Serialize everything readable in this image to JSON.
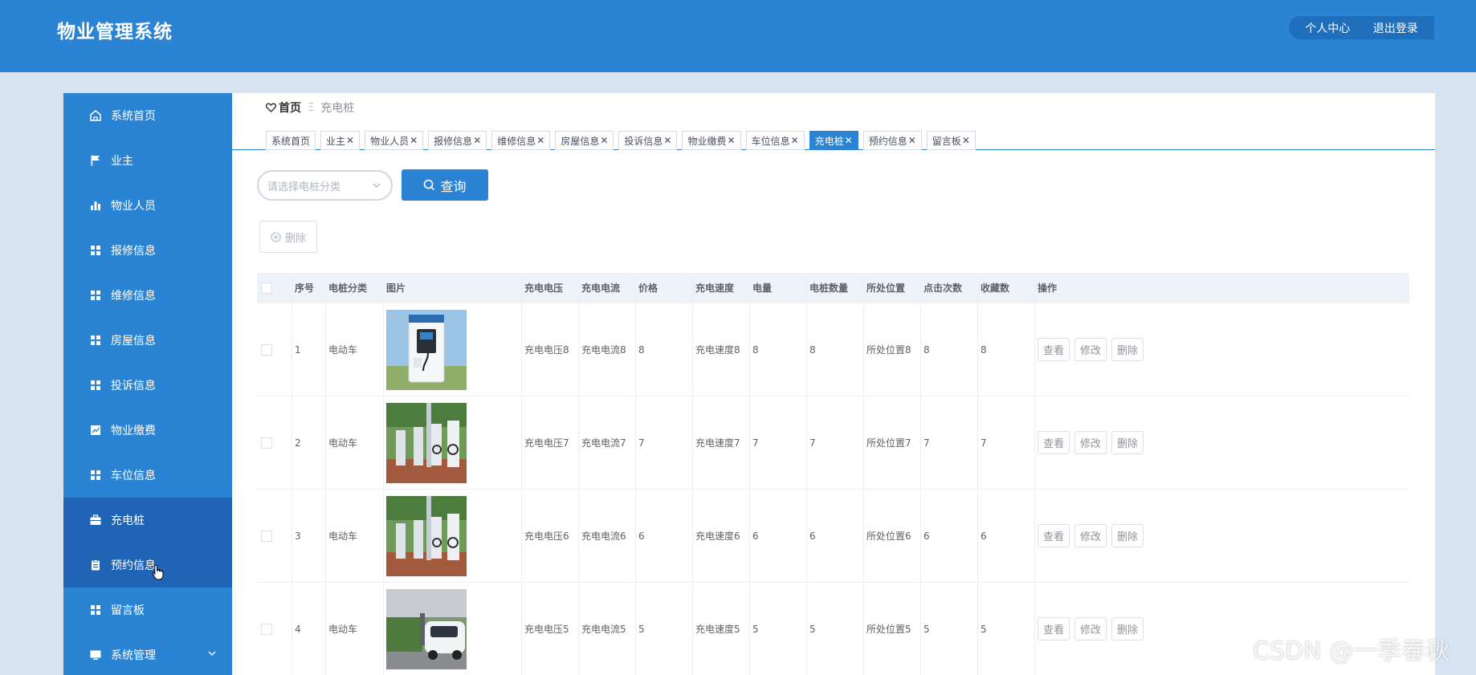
{
  "header": {
    "title": "物业管理系统",
    "personal_center": "个人中心",
    "logout": "退出登录"
  },
  "sidebar": {
    "items": [
      {
        "label": "系统首页",
        "icon": "home-icon"
      },
      {
        "label": "业主",
        "icon": "flag-icon"
      },
      {
        "label": "物业人员",
        "icon": "bar-chart-icon"
      },
      {
        "label": "报修信息",
        "icon": "grid-icon"
      },
      {
        "label": "维修信息",
        "icon": "grid-icon"
      },
      {
        "label": "房屋信息",
        "icon": "grid-icon"
      },
      {
        "label": "投诉信息",
        "icon": "grid-icon"
      },
      {
        "label": "物业缴费",
        "icon": "line-chart-icon"
      },
      {
        "label": "车位信息",
        "icon": "grid-icon"
      },
      {
        "label": "充电桩",
        "icon": "briefcase-icon",
        "active": true
      },
      {
        "label": "预约信息",
        "icon": "clipboard-icon",
        "hover": true
      },
      {
        "label": "留言板",
        "icon": "grid-icon"
      },
      {
        "label": "系统管理",
        "icon": "monitor-icon",
        "has_submenu": true
      }
    ]
  },
  "breadcrumb": {
    "home": "首页",
    "separator": "Ξ",
    "current": "充电桩"
  },
  "tags": [
    {
      "label": "系统首页",
      "closable": false
    },
    {
      "label": "业主",
      "closable": true
    },
    {
      "label": "物业人员",
      "closable": true
    },
    {
      "label": "报修信息",
      "closable": true
    },
    {
      "label": "维修信息",
      "closable": true
    },
    {
      "label": "房屋信息",
      "closable": true
    },
    {
      "label": "投诉信息",
      "closable": true
    },
    {
      "label": "物业缴费",
      "closable": true
    },
    {
      "label": "车位信息",
      "closable": true
    },
    {
      "label": "充电桩",
      "closable": true,
      "active": true
    },
    {
      "label": "预约信息",
      "closable": true
    },
    {
      "label": "留言板",
      "closable": true
    }
  ],
  "search": {
    "category_placeholder": "请选择电桩分类",
    "query_button": "查询"
  },
  "toolbar": {
    "delete_button": "删除"
  },
  "table": {
    "columns": [
      "序号",
      "电桩分类",
      "图片",
      "充电电压",
      "充电电流",
      "价格",
      "充电速度",
      "电量",
      "电桩数量",
      "所处位置",
      "点击次数",
      "收藏数",
      "操作"
    ],
    "rows": [
      {
        "index": "1",
        "category": "电动车",
        "image": "charger-cabinet-photo",
        "voltage": "充电电压8",
        "current": "充电电流8",
        "price": "8",
        "speed": "充电速度8",
        "power": "8",
        "count": "8",
        "location": "所处位置8",
        "clicks": "8",
        "favorites": "8"
      },
      {
        "index": "2",
        "category": "电动车",
        "image": "charger-row-photo",
        "voltage": "充电电压7",
        "current": "充电电流7",
        "price": "7",
        "speed": "充电速度7",
        "power": "7",
        "count": "7",
        "location": "所处位置7",
        "clicks": "7",
        "favorites": "7"
      },
      {
        "index": "3",
        "category": "电动车",
        "image": "charger-row-photo",
        "voltage": "充电电压6",
        "current": "充电电流6",
        "price": "6",
        "speed": "充电速度6",
        "power": "6",
        "count": "6",
        "location": "所处位置6",
        "clicks": "6",
        "favorites": "6"
      },
      {
        "index": "4",
        "category": "电动车",
        "image": "car-charging-photo",
        "voltage": "充电电压5",
        "current": "充电电流5",
        "price": "5",
        "speed": "充电速度5",
        "power": "5",
        "count": "5",
        "location": "所处位置5",
        "clicks": "5",
        "favorites": "5"
      }
    ],
    "actions": {
      "view": "查看",
      "edit": "修改",
      "delete": "删除"
    }
  },
  "watermark": "CSDN @一季春秋",
  "colors": {
    "primary": "#2b84d3",
    "sidebar_active": "#1f64b5",
    "page_bg": "#d7e3f1"
  }
}
